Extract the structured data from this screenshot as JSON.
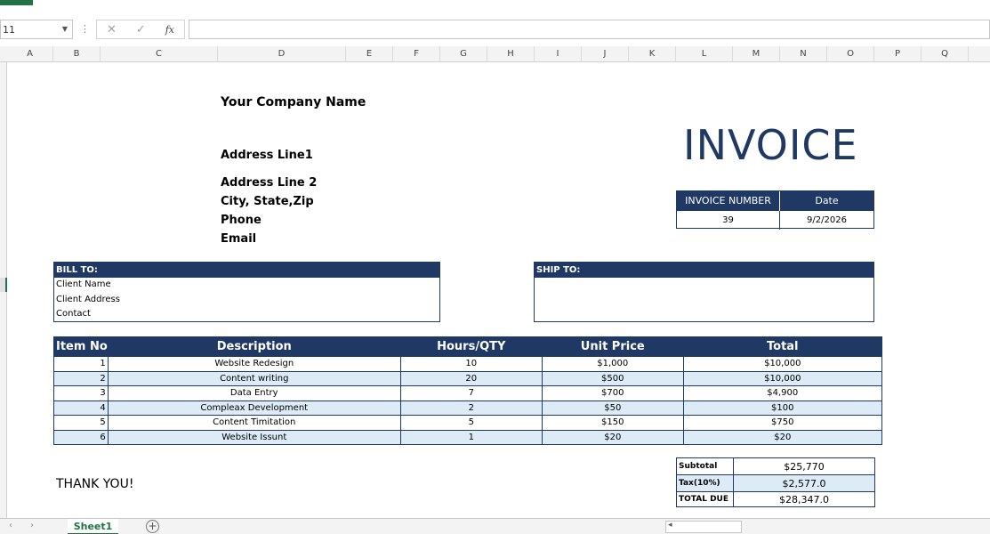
{
  "formula_bar": {
    "name_box": "11",
    "fx_label": "fx",
    "formula": ""
  },
  "columns": [
    "A",
    "B",
    "C",
    "D",
    "E",
    "F",
    "G",
    "H",
    "I",
    "J",
    "K",
    "L",
    "M",
    "N",
    "O",
    "P",
    "Q"
  ],
  "invoice": {
    "company_name": "Your Company Name",
    "address1": "Address Line1",
    "address2": "Address Line 2",
    "city": "City, State,Zip",
    "phone": "Phone",
    "email": "Email",
    "title": "INVOICE",
    "number_header": "INVOICE NUMBER",
    "date_header": "Date",
    "number": "39",
    "date": "9/2/2026",
    "bill_to_header": "BILL TO:",
    "bill_to": [
      "Client Name",
      "Client Address",
      "Contact"
    ],
    "ship_to_header": "SHIP TO:",
    "table_headers": [
      "Item No",
      "Description",
      "Hours/QTY",
      "Unit Price",
      "Total"
    ],
    "items": [
      {
        "no": "1",
        "desc": "Website Redesign",
        "qty": "10",
        "price": "$1,000",
        "total": "$10,000"
      },
      {
        "no": "2",
        "desc": "Content writing",
        "qty": "20",
        "price": "$500",
        "total": "$10,000"
      },
      {
        "no": "3",
        "desc": "Data Entry",
        "qty": "7",
        "price": "$700",
        "total": "$4,900"
      },
      {
        "no": "4",
        "desc": "Compleax Development",
        "qty": "2",
        "price": "$50",
        "total": "$100"
      },
      {
        "no": "5",
        "desc": "Content Timitation",
        "qty": "5",
        "price": "$150",
        "total": "$750"
      },
      {
        "no": "6",
        "desc": "Website Issunt",
        "qty": "1",
        "price": "$20",
        "total": "$20"
      }
    ],
    "thank_you": "THANK YOU!",
    "subtotal_label": "Subtotal",
    "subtotal": "$25,770",
    "tax_label": "Tax(10%)",
    "tax": "$2,577.0",
    "total_due_label": "TOTAL DUE",
    "total_due": "$28,347.0"
  },
  "sheet_tabs": {
    "active": "Sheet1",
    "add": "+"
  },
  "colors": {
    "header_navy": "#1f3864",
    "row_alt": "#ddebf7",
    "excel_green": "#217346"
  }
}
